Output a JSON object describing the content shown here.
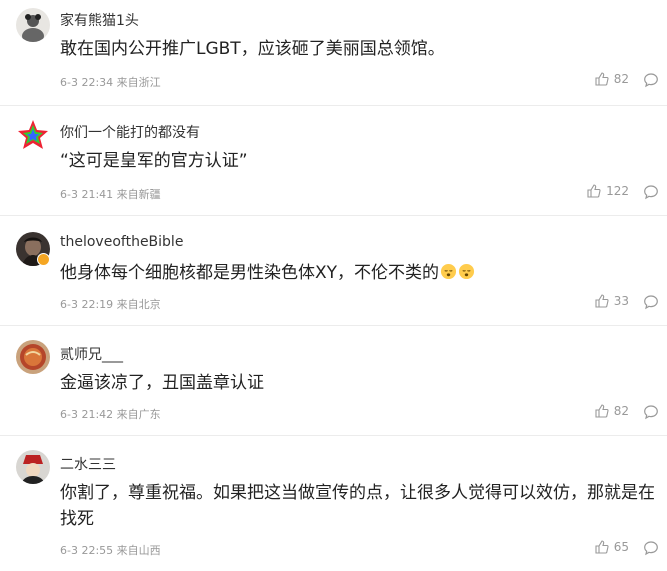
{
  "comments": [
    {
      "username": "家有熊猫1头",
      "content": "敢在国内公开推广LGBT，应该砸了美丽国总领馆。",
      "time": "6-3 22:34",
      "location": "来自浙江",
      "likes": "82"
    },
    {
      "username": "你们一个能打的都没有",
      "content": "“这可是皇军的官方认证”",
      "time": "6-3 21:41",
      "location": "来自新疆",
      "likes": "122"
    },
    {
      "username": "theloveoftheBible",
      "content": "他身体每个细胞核都是男性染色体XY，不伦不类的",
      "time": "6-3 22:19",
      "location": "来自北京",
      "likes": "33"
    },
    {
      "username": "贰师兄___",
      "content": "金逼该凉了，丑国盖章认证",
      "time": "6-3 21:42",
      "location": "来自广东",
      "likes": "82"
    },
    {
      "username": "二水三三",
      "content": "你割了，尊重祝福。如果把这当做宣传的点，让很多人觉得可以效仿，那就是在找死",
      "time": "6-3 22:55",
      "location": "来自山西",
      "likes": "65"
    }
  ],
  "icons": {
    "like": "thumbs-up-icon",
    "reply": "comment-bubble-icon",
    "emoji": "sleepy-face-emoji"
  },
  "colors": {
    "text": "#222222",
    "meta": "#999999",
    "divider": "#ececec",
    "badge": "#f5a623"
  }
}
